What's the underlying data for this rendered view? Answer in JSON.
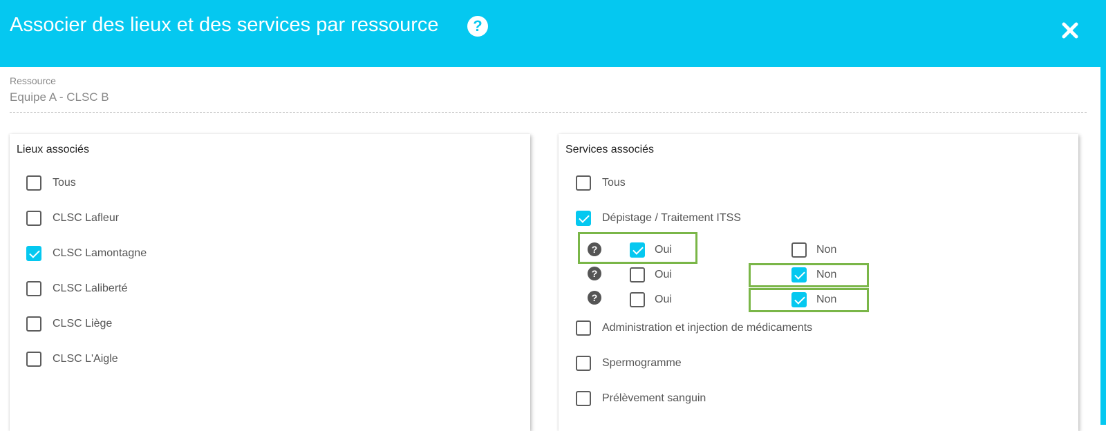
{
  "header": {
    "title": "Associer des lieux et des services par ressource",
    "help_glyph": "?",
    "background": "#05c8f0"
  },
  "resource": {
    "label": "Ressource",
    "value": "Equipe A - CLSC B"
  },
  "lieux": {
    "title": "Lieux associés",
    "items": [
      {
        "label": "Tous",
        "checked": false
      },
      {
        "label": "CLSC Lafleur",
        "checked": false
      },
      {
        "label": "CLSC Lamontagne",
        "checked": true
      },
      {
        "label": "CLSC Laliberté",
        "checked": false
      },
      {
        "label": "CLSC Liège",
        "checked": false
      },
      {
        "label": "CLSC L'Aigle",
        "checked": false
      }
    ]
  },
  "services": {
    "title": "Services associés",
    "tous": {
      "label": "Tous",
      "checked": false
    },
    "depistage": {
      "label": "Dépistage / Traitement ITSS",
      "checked": true,
      "options": [
        {
          "help": "?",
          "oui_label": "Oui",
          "oui_checked": true,
          "non_label": "Non",
          "non_checked": false,
          "highlight": "oui"
        },
        {
          "help": "?",
          "oui_label": "Oui",
          "oui_checked": false,
          "non_label": "Non",
          "non_checked": true,
          "highlight": "non"
        },
        {
          "help": "?",
          "oui_label": "Oui",
          "oui_checked": false,
          "non_label": "Non",
          "non_checked": true,
          "highlight": "non"
        }
      ]
    },
    "others": [
      {
        "label": "Administration et injection de médicaments",
        "checked": false
      },
      {
        "label": "Spermogramme",
        "checked": false
      },
      {
        "label": "Prélèvement sanguin",
        "checked": false
      }
    ]
  },
  "colors": {
    "accent": "#05c8f0",
    "highlight": "#7ab648",
    "checkbox_border": "#5c5c5c"
  }
}
